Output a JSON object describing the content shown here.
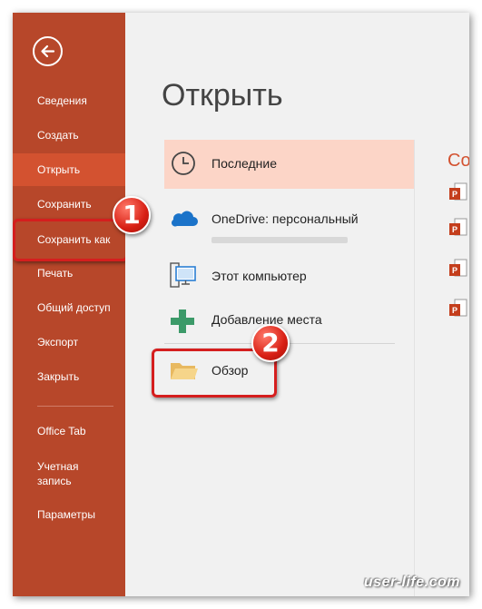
{
  "sidebar": {
    "back_icon": "arrow-left-icon",
    "items": [
      {
        "label": "Сведения"
      },
      {
        "label": "Создать"
      },
      {
        "label": "Открыть"
      },
      {
        "label": "Сохранить"
      },
      {
        "label": "Сохранить как"
      },
      {
        "label": "Печать"
      },
      {
        "label": "Общий доступ"
      },
      {
        "label": "Экспорт"
      },
      {
        "label": "Закрыть"
      },
      {
        "label": "Office Tab"
      },
      {
        "label": "Учетная запись"
      },
      {
        "label": "Параметры"
      }
    ]
  },
  "main": {
    "title": "Открыть",
    "places": [
      {
        "label": "Последние",
        "icon": "clock-icon"
      },
      {
        "label": "OneDrive: персональный",
        "icon": "cloud-icon"
      },
      {
        "label": "Этот компьютер",
        "icon": "computer-icon"
      },
      {
        "label": "Добавление места",
        "icon": "plus-icon"
      },
      {
        "label": "Обзор",
        "icon": "folder-icon"
      }
    ],
    "right_header": "Со"
  },
  "badges": {
    "one": "1",
    "two": "2"
  },
  "watermark": "user-life.com",
  "colors": {
    "sidebar": "#b7472a",
    "active": "#d35230",
    "recent_highlight": "#fcd5c7",
    "annotation": "#d51e1e"
  }
}
